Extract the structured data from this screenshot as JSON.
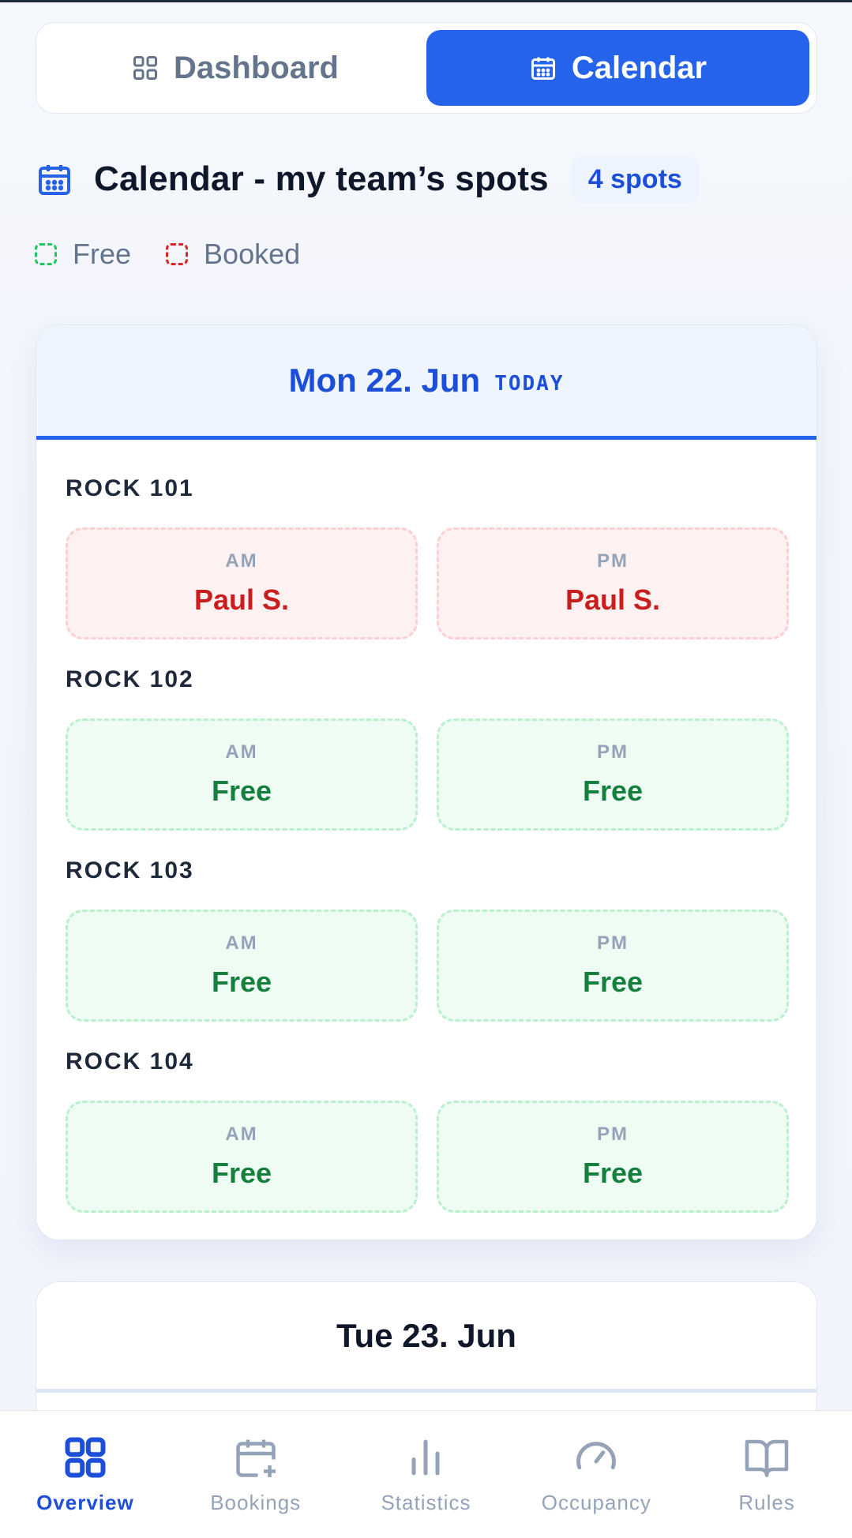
{
  "toggle": {
    "dashboard_label": "Dashboard",
    "calendar_label": "Calendar",
    "active": "calendar"
  },
  "header": {
    "title": "Calendar - my team’s spots",
    "spots_badge": "4 spots"
  },
  "legend": {
    "free": "Free",
    "booked": "Booked"
  },
  "days": [
    {
      "title": "Mon 22. Jun",
      "today_tag": "TODAY",
      "spots": [
        {
          "name": "ROCK 101",
          "am": {
            "period": "AM",
            "value": "Paul S.",
            "status": "booked"
          },
          "pm": {
            "period": "PM",
            "value": "Paul S.",
            "status": "booked"
          }
        },
        {
          "name": "ROCK 102",
          "am": {
            "period": "AM",
            "value": "Free",
            "status": "free"
          },
          "pm": {
            "period": "PM",
            "value": "Free",
            "status": "free"
          }
        },
        {
          "name": "ROCK 103",
          "am": {
            "period": "AM",
            "value": "Free",
            "status": "free"
          },
          "pm": {
            "period": "PM",
            "value": "Free",
            "status": "free"
          }
        },
        {
          "name": "ROCK 104",
          "am": {
            "period": "AM",
            "value": "Free",
            "status": "free"
          },
          "pm": {
            "period": "PM",
            "value": "Free",
            "status": "free"
          }
        }
      ]
    },
    {
      "title": "Tue 23. Jun"
    }
  ],
  "nav": {
    "overview": "Overview",
    "bookings": "Bookings",
    "statistics": "Statistics",
    "occupancy": "Occupancy",
    "rules": "Rules",
    "active": "overview"
  },
  "colors": {
    "accent": "#2563eb",
    "booked": "#c81e1e",
    "free": "#15803d"
  }
}
